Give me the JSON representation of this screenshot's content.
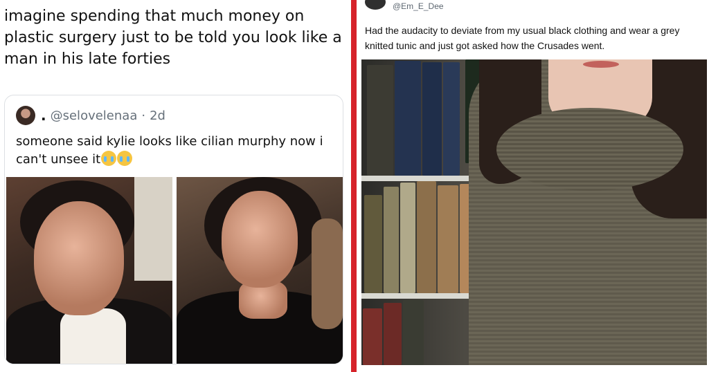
{
  "left_tweet": {
    "text": "imagine spending that much money on plastic surgery just to be told you look like a man in his late forties",
    "quote": {
      "dot": ".",
      "handle": "@selovelenaa",
      "separator": "·",
      "time": "2d",
      "text": "someone said kylie looks like cilian murphy now i can't unsee it"
    }
  },
  "right_tweet": {
    "handle": "@Em_E_Dee",
    "text": "Had the audacity to deviate from my usual black clothing and wear a grey knitted tunic and just got asked how the Crusades went."
  },
  "colors": {
    "divider": "#d6232a",
    "muted_text": "#66707a"
  },
  "icons": [
    "loudly-crying-face-icon",
    "loudly-crying-face-icon"
  ]
}
